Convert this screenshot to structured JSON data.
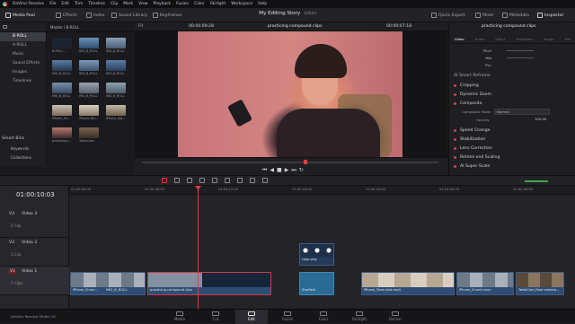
{
  "app": {
    "name": "DaVinci Resolve",
    "edition_label": "DaVinci Resolve Studio 20"
  },
  "menubar": {
    "items": [
      "DaVinci Resolve",
      "File",
      "Edit",
      "Trim",
      "Timeline",
      "Clip",
      "Mark",
      "View",
      "Playback",
      "Fusion",
      "Color",
      "Fairlight",
      "Workspace",
      "Help"
    ]
  },
  "toolbar": {
    "media_pool": "Media Pool",
    "effects": "Effects",
    "index": "Index",
    "sound_library": "Sound Library",
    "keyframes": "Keyframes",
    "project_title": "My Editing Story",
    "project_status": "Edited",
    "quick_export": "Quick Export",
    "mixer": "Mixer",
    "metadata": "Metadata",
    "inspector": "Inspector"
  },
  "media_pool": {
    "path": "Master / B-ROLL",
    "bins": [
      "B-ROLL",
      "A-ROLL",
      "Music",
      "Sound Effects",
      "Images",
      "Timelines"
    ],
    "selected_bin": "B-ROLL",
    "smart_bins_title": "Smart Bins",
    "smart_bins": [
      "Keywords",
      "Collections"
    ],
    "clips": [
      {
        "label": "B-ROLL..."
      },
      {
        "label": "IMG_B_ROLL"
      },
      {
        "label": "IMG_B_ROLL"
      },
      {
        "label": "IMG_B_ROLL"
      },
      {
        "label": "IMG_B_ROLL"
      },
      {
        "label": "IMG_B_ROLL"
      },
      {
        "label": "IMG_B_ROLL"
      },
      {
        "label": "IMG_B_ROLL"
      },
      {
        "label": "IMG_B_ROLL"
      },
      {
        "label": "iPhone_Ch..."
      },
      {
        "label": "iPhone_Tes..."
      },
      {
        "label": "iPhone_Sat..."
      },
      {
        "label": "practicing c..."
      },
      {
        "label": "TestaCam..."
      }
    ]
  },
  "viewer": {
    "zoom": "Fit",
    "source_timecode": "00:00:09:28",
    "clip_title": "practicing compound clips",
    "record_timecode": "00:00:07:18"
  },
  "inspector": {
    "clip_title": "practicing compound clips",
    "tabs": [
      "Video",
      "Audio",
      "Effect",
      "Transition",
      "Image",
      "File"
    ],
    "active_tab": "Video",
    "params": [
      {
        "label": "Pitch"
      },
      {
        "label": "Yaw"
      },
      {
        "label": "Flip"
      }
    ],
    "sections": [
      "AI Smart Reframe",
      "Cropping",
      "Dynamic Zoom",
      "Composite",
      "Speed Change",
      "Stabilization",
      "Lens Correction",
      "Retime and Scaling",
      "AI Super Scale"
    ],
    "composite_mode_label": "Composite Mode",
    "composite_mode_value": "Normal",
    "opacity_label": "Opacity",
    "opacity_value": "100.00"
  },
  "timeline": {
    "timecode": "01:00:10:03",
    "ruler": [
      "01:00:00:00",
      "01:00:06:00",
      "01:00:12:00",
      "01:00:18:00",
      "01:00:24:00",
      "01:00:30:00",
      "01:00:36:00",
      "01:00:42:00",
      "01:00:48:00"
    ],
    "tracks": [
      {
        "id": "V3",
        "name": "Video 3",
        "clips": "0 Clip"
      },
      {
        "id": "V2",
        "name": "Video 2",
        "clips": "1 Clip"
      },
      {
        "id": "V1",
        "name": "Video 1",
        "clips": "7 Clips"
      }
    ],
    "clips_v2": [
      {
        "label": "Logo.png"
      }
    ],
    "clips_v1": [
      {
        "label": "iPhone_Churc..."
      },
      {
        "label": "IMG_B_ROLL"
      },
      {
        "label": "practicing compound clips"
      },
      {
        "label": "Starfield"
      },
      {
        "label": "iPhone_Tesla shot.mp4"
      },
      {
        "label": "iPhone_Church.mov"
      },
      {
        "label": "TestaCam_floor camera..."
      }
    ]
  },
  "pages": [
    "Media",
    "Cut",
    "Edit",
    "Fusion",
    "Color",
    "Fairlight",
    "Deliver"
  ],
  "active_page": "Edit",
  "colors": {
    "accent": "#e23b3b",
    "clip_blue": "#2f4d74"
  }
}
